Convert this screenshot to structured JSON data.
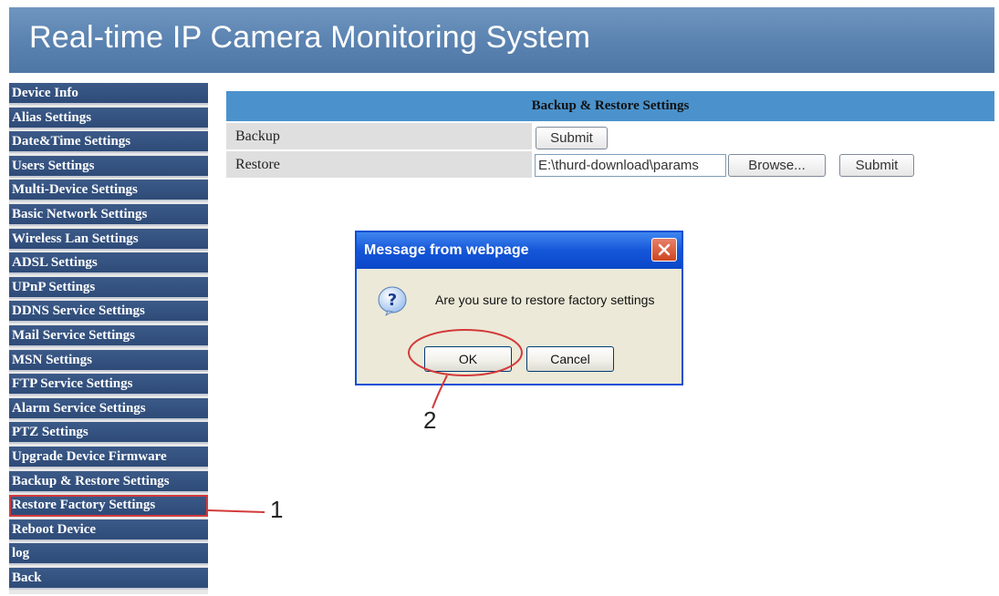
{
  "header": {
    "title": "Real-time IP Camera Monitoring System"
  },
  "sidebar": {
    "items": [
      "Device Info",
      "Alias Settings",
      "Date&Time Settings",
      "Users Settings",
      "Multi-Device Settings",
      "Basic Network Settings",
      "Wireless Lan Settings",
      "ADSL Settings",
      "UPnP Settings",
      "DDNS Service Settings",
      "Mail Service Settings",
      "MSN Settings",
      "FTP Service Settings",
      "Alarm Service Settings",
      "PTZ Settings",
      "Upgrade Device Firmware",
      "Backup & Restore Settings",
      "Restore Factory Settings",
      "Reboot Device",
      "log",
      "Back"
    ]
  },
  "panel": {
    "title": "Backup & Restore Settings",
    "backup": {
      "label": "Backup",
      "submit": "Submit"
    },
    "restore": {
      "label": "Restore",
      "file_value": "E:\\thurd-download\\params",
      "browse": "Browse...",
      "submit": "Submit"
    }
  },
  "dialog": {
    "title": "Message from webpage",
    "message": "Are you sure to restore factory settings",
    "ok": "OK",
    "cancel": "Cancel"
  },
  "annotations": {
    "step1": "1",
    "step2": "2"
  },
  "colors": {
    "header": "#5a82b0",
    "menu": "#2e4b78",
    "panel_head": "#4b92cc",
    "annotation_red": "#d33a3a"
  }
}
